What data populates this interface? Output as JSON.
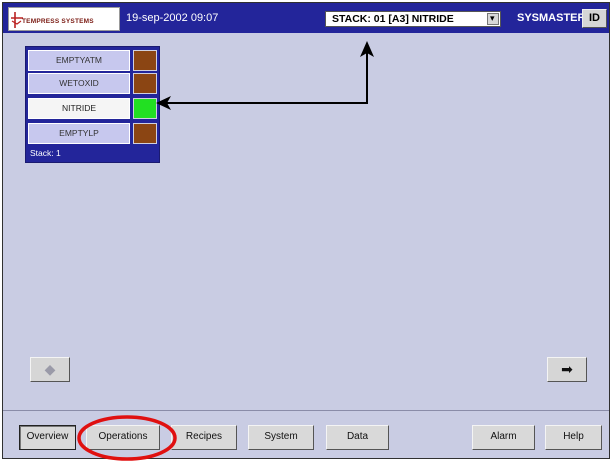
{
  "header": {
    "logo_text": "TEMPRESS SYSTEMS",
    "datetime": "19-sep-2002 09:07",
    "stack_select_value": "STACK: 01 [A3] NITRIDE",
    "user": "SYSMASTER",
    "id_label": "ID"
  },
  "stack": {
    "caption": "Stack: 1",
    "slots": [
      {
        "label": "EMPTYATM",
        "color": "#8b4513",
        "active": false
      },
      {
        "label": "WETOXID",
        "color": "#8b4513",
        "active": false
      },
      {
        "label": "NITRIDE",
        "color": "#22e022",
        "active": true
      },
      {
        "label": "EMPTYLP",
        "color": "#8b4513",
        "active": false
      }
    ]
  },
  "nav": {
    "prev_icon": "arrow-left-icon",
    "next_icon": "arrow-right-icon",
    "prev_glyph": "◆",
    "next_glyph": "➡"
  },
  "toolbar": {
    "overview": "Overview",
    "operations": "Operations",
    "recipes": "Recipes",
    "system": "System",
    "data": "Data",
    "alarm": "Alarm",
    "help": "Help",
    "selected": "overview"
  },
  "annotation": {
    "highlight_color": "#e01010",
    "highlight_target": "operations"
  }
}
